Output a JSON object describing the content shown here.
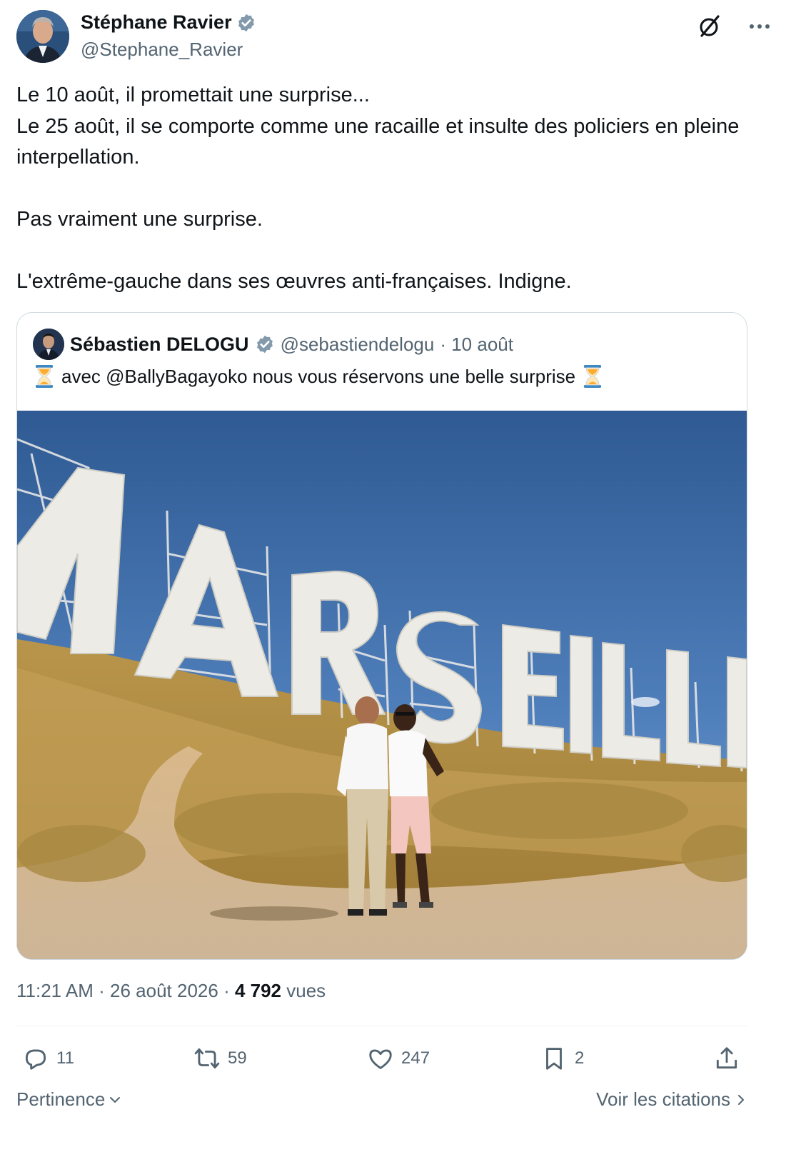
{
  "author": {
    "name": "Stéphane Ravier",
    "handle": "@Stephane_Ravier",
    "verified_color": "#829aab"
  },
  "tweet": {
    "lines": [
      "Le 10 août, il promettait une surprise...",
      "Le 25 août, il se comporte comme une racaille et insulte des policiers en pleine interpellation.",
      "Pas vraiment une surprise.",
      "L'extrême-gauche dans ses œuvres anti-françaises. Indigne."
    ]
  },
  "quote": {
    "name": "Sébastien DELOGU",
    "handle": "@sebastiendelogu",
    "date": "· 10 août",
    "text": "avec @BallyBagayoko nous vous réservons une belle surprise",
    "image_sign": "MARSEILLE"
  },
  "meta": {
    "time": "11:21 AM · 26 août 2026 · ",
    "views_count": "4 792",
    "views_label": " vues"
  },
  "actions": {
    "replies": "11",
    "reposts": "59",
    "likes": "247",
    "bookmarks": "2"
  },
  "footer": {
    "sort_label": "Pertinence",
    "citations_label": "Voir les citations"
  },
  "colors": {
    "text": "#0f1419",
    "secondary": "#536471",
    "border": "#cfd9de"
  },
  "icons": [
    "grok-icon",
    "more-icon",
    "reply-icon",
    "repost-icon",
    "like-icon",
    "bookmark-icon",
    "share-icon",
    "verified-badge-icon",
    "hourglass-icon"
  ]
}
